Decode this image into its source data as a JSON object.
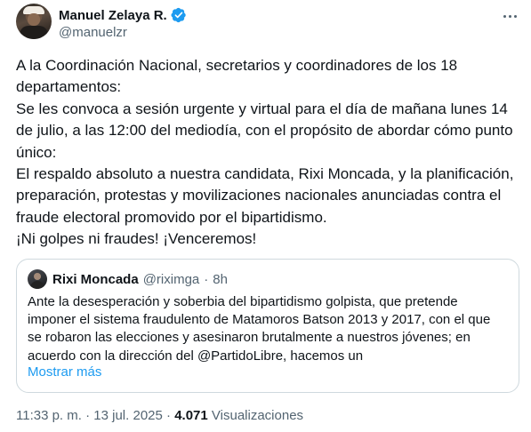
{
  "author": {
    "display_name": "Manuel Zelaya R.",
    "handle": "@manuelzr",
    "verified": true,
    "verified_color": "#1d9bf0"
  },
  "tweet": {
    "lines": [
      "A la Coordinación Nacional, secretarios y coordinadores de los 18 departamentos:",
      "Se les convoca a sesión urgente y virtual para el día de mañana lunes 14 de julio, a las 12:00 del mediodía, con el propósito de abordar cómo punto único:",
      "El respaldo absoluto a nuestra candidata, Rixi Moncada, y la planificación, preparación, protestas y movilizaciones nacionales anunciadas contra el fraude electoral promovido por el bipartidismo.",
      "¡Ni golpes ni fraudes! ¡Venceremos!"
    ]
  },
  "quoted": {
    "display_name": "Rixi Moncada",
    "handle": "@riximga",
    "separator": "·",
    "time": "8h",
    "text": "Ante la desesperación y soberbia del bipartidismo golpista, que pretende imponer el sistema fraudulento de Matamoros Batson 2013 y 2017, con el que se robaron las elecciones y asesinaron brutalmente a nuestros jóvenes; en acuerdo con la dirección del @PartidoLibre, hacemos un",
    "show_more": "Mostrar más"
  },
  "meta": {
    "time": "11:33 p. m.",
    "sep1": "·",
    "date": "13 jul. 2025",
    "sep2": "·",
    "views_count": "4.071",
    "views_label": "Visualizaciones"
  },
  "icons": {
    "more": "more-horizontal-icon",
    "verified": "verified-badge-icon"
  },
  "colors": {
    "text": "#0f1419",
    "secondary": "#536471",
    "link": "#1d9bf0",
    "border": "#cfd9de"
  }
}
